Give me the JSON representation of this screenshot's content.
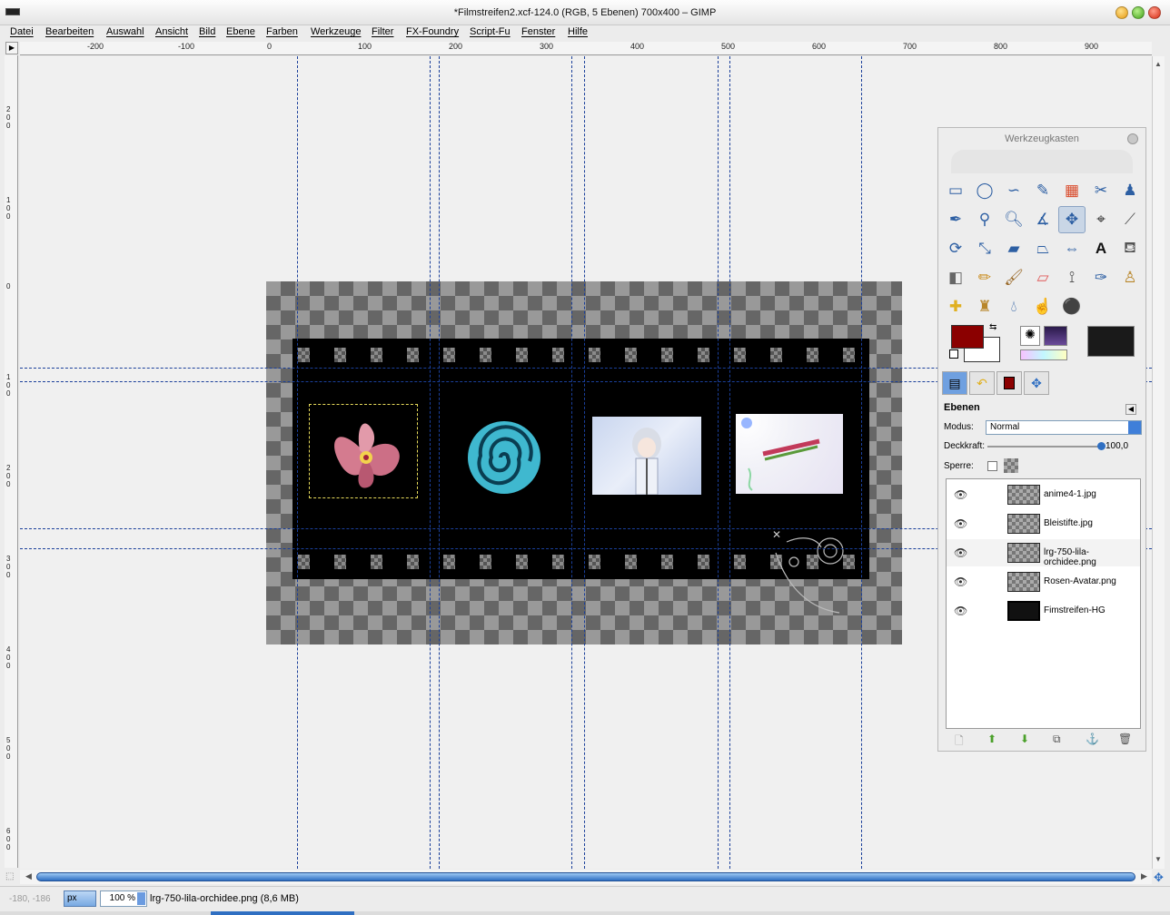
{
  "window": {
    "title": "*Filmstreifen2.xcf-124.0 (RGB, 5 Ebenen) 700x400 – GIMP"
  },
  "menu": [
    "Datei",
    "Bearbeiten",
    "Auswahl",
    "Ansicht",
    "Bild",
    "Ebene",
    "Farben",
    "Werkzeuge",
    "Filter",
    "FX-Foundry",
    "Script-Fu",
    "Fenster",
    "Hilfe"
  ],
  "ruler_h_labels": [
    "-200",
    "-100",
    "0",
    "100",
    "200",
    "300",
    "400",
    "500",
    "600",
    "700",
    "800",
    "900"
  ],
  "ruler_v_labels": [
    "200",
    "100",
    "0",
    "100",
    "200",
    "300",
    "400",
    "500",
    "600"
  ],
  "toolbox": {
    "title": "Werkzeugkasten",
    "tools": [
      "rect-select",
      "ellipse-select",
      "free-select",
      "fuzzy-select",
      "color-select",
      "scissors",
      "foreground-select",
      "paths",
      "color-picker",
      "zoom",
      "measure",
      "move",
      "align",
      "crop",
      "rotate",
      "scale",
      "shear",
      "perspective",
      "flip",
      "text",
      "bucket-fill",
      "blend",
      "pencil",
      "paintbrush",
      "eraser",
      "airbrush",
      "ink",
      "clone",
      "heal",
      "perspective-clone",
      "blur",
      "smudge",
      "dodge-burn"
    ],
    "fg_color": "#8b0000",
    "bg_color": "#ffffff"
  },
  "layers_panel": {
    "title": "Ebenen",
    "mode_label": "Modus:",
    "mode_value": "Normal",
    "opacity_label": "Deckkraft:",
    "opacity_value": "100,0",
    "lock_label": "Sperre:",
    "layers": [
      {
        "name": "anime4-1.jpg",
        "selected": false
      },
      {
        "name": "Bleistifte.jpg",
        "selected": false
      },
      {
        "name": "lrg-750-lila-orchidee.png",
        "selected": true
      },
      {
        "name": "Rosen-Avatar.png",
        "selected": false
      },
      {
        "name": "Fimstreifen-HG",
        "selected": false
      }
    ]
  },
  "status": {
    "coords": "-180, -186",
    "unit": "px",
    "zoom": "100 %",
    "text": "lrg-750-lila-orchidee.png (8,6 MB)"
  }
}
